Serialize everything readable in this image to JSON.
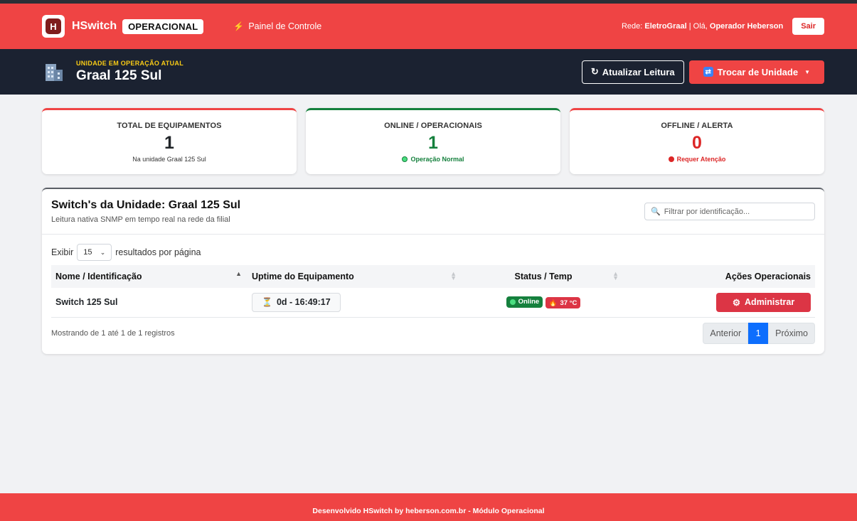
{
  "navbar": {
    "brand": "HSwitch",
    "badge": "OPERACIONAL",
    "nav_link": "Painel de Controle",
    "network_label": "Rede:",
    "network_name": "EletroGraal",
    "separator": " | Olá, ",
    "operator": "Operador Heberson",
    "logout": "Sair"
  },
  "unit": {
    "label": "UNIDADE EM OPERAÇÃO ATUAL",
    "name": "Graal 125 Sul",
    "refresh_button": "Atualizar Leitura",
    "switch_button": "Trocar de Unidade"
  },
  "cards": [
    {
      "title": "TOTAL DE EQUIPAMENTOS",
      "value": "1",
      "sub": "Na unidade Graal 125 Sul",
      "color": "#212529"
    },
    {
      "title": "ONLINE / OPERACIONAIS",
      "value": "1",
      "sub": "Operação Normal",
      "color": "#15803d"
    },
    {
      "title": "OFFLINE / ALERTA",
      "value": "0",
      "sub": "Requer Atenção",
      "color": "#dc2626"
    }
  ],
  "panel": {
    "title": "Switch's da Unidade: Graal 125 Sul",
    "subtitle": "Leitura nativa SNMP em tempo real na rede da filial",
    "filter_placeholder": "Filtrar por identificação...",
    "show_label": "Exibir",
    "page_length": "15",
    "per_page_label": "resultados por página",
    "columns": [
      "Nome / Identificação",
      "Uptime do Equipamento",
      "Status / Temp",
      "Ações Operacionais"
    ],
    "rows": [
      {
        "name": "Switch 125 Sul",
        "uptime": "0d - 16:49:17",
        "status": "Online",
        "temp": "37 °C",
        "action": "Administrar"
      }
    ],
    "info": "Mostrando de 1 até 1 de 1 registros",
    "pager": {
      "prev": "Anterior",
      "page": "1",
      "next": "Próximo"
    }
  },
  "footer": "Desenvolvido HSwitch by heberson.com.br - Módulo Operacional",
  "icons": {
    "brand": "hswitch-logo",
    "nav": "bolt-icon",
    "unit": "building-icon",
    "refresh": "refresh-icon",
    "switch": "sync-icon",
    "search": "search-icon",
    "uptime": "hourglass-icon",
    "temp": "flame-icon",
    "admin": "gear-icon"
  }
}
